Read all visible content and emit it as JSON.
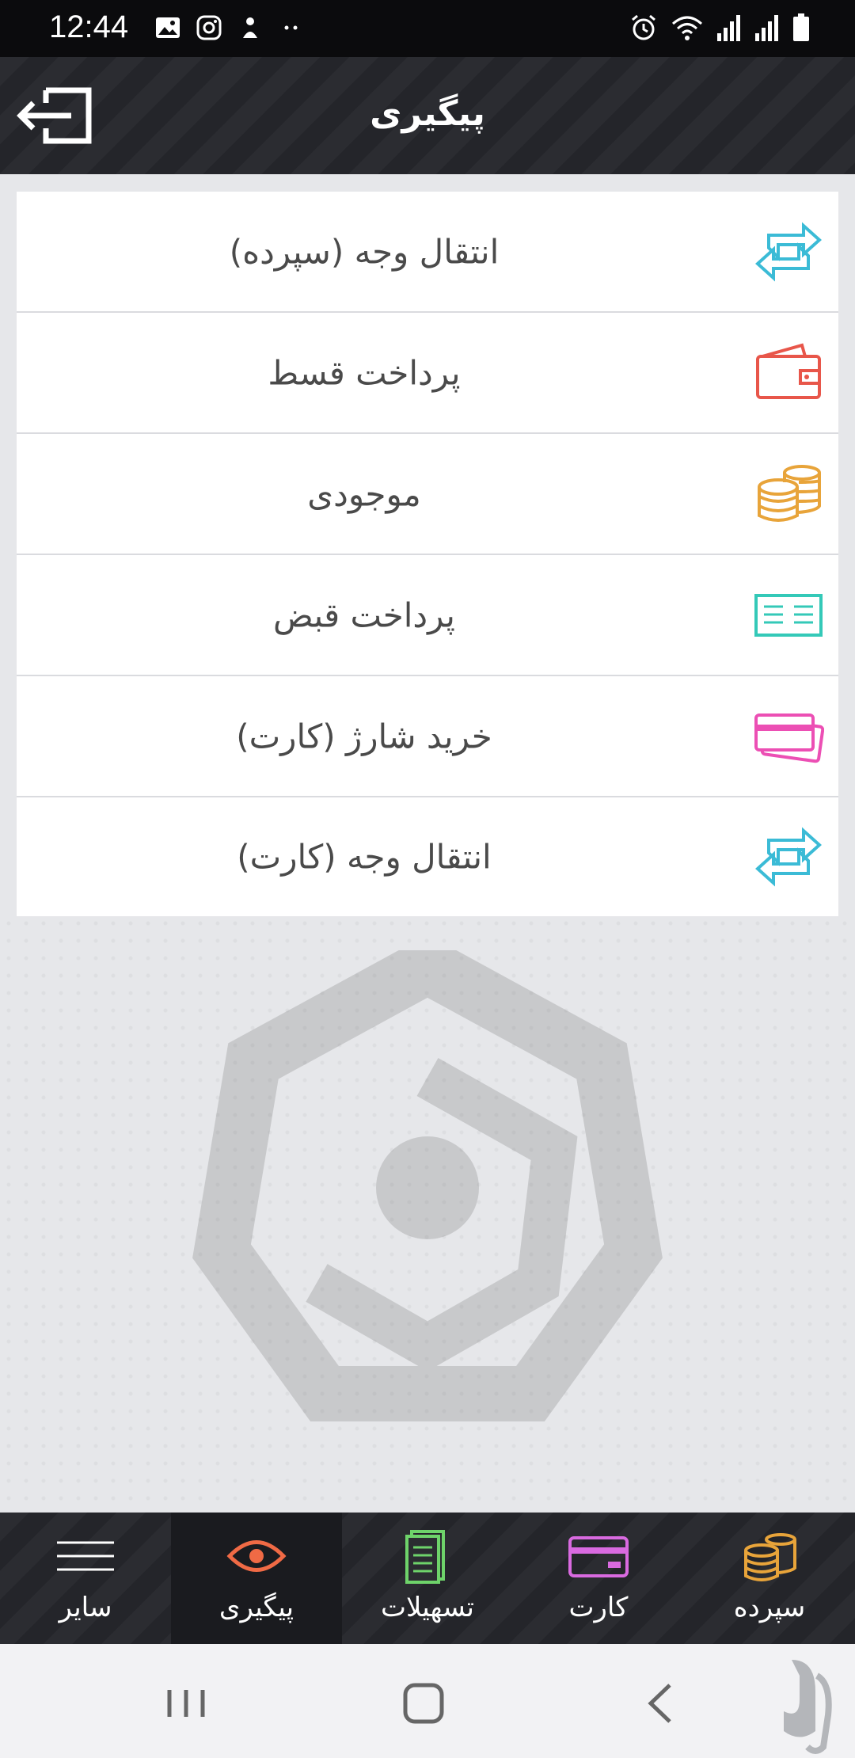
{
  "status_bar": {
    "time": "12:44"
  },
  "header": {
    "title": "پیگیری"
  },
  "menu": {
    "items": [
      {
        "label": "انتقال وجه (سپرده)",
        "icon": "transfer-arrows-icon",
        "color": "#3bbbd6"
      },
      {
        "label": "پرداخت قسط",
        "icon": "wallet-icon",
        "color": "#e8564a"
      },
      {
        "label": "موجودی",
        "icon": "coins-icon",
        "color": "#e8a43a"
      },
      {
        "label": "پرداخت قبض",
        "icon": "bill-icon",
        "color": "#34c9b8"
      },
      {
        "label": "خرید شارژ (کارت)",
        "icon": "cards-icon",
        "color": "#ec4fb4"
      },
      {
        "label": "انتقال وجه (کارت)",
        "icon": "transfer-arrows-icon",
        "color": "#3bbbd6"
      }
    ]
  },
  "bottom_nav": {
    "items": [
      {
        "label": "سایر",
        "icon": "hamburger-menu-icon",
        "color": "#ffffff"
      },
      {
        "label": "پیگیری",
        "icon": "eye-icon",
        "color": "#f06a45",
        "active": true
      },
      {
        "label": "تسهیلات",
        "icon": "document-icon",
        "color": "#6ed36a"
      },
      {
        "label": "کارت",
        "icon": "credit-card-icon",
        "color": "#d96ae0"
      },
      {
        "label": "سپرده",
        "icon": "coins-icon",
        "color": "#e8a43a"
      }
    ]
  },
  "colors": {
    "header_bg": "#2b2c31",
    "page_bg": "#e6e7ea",
    "active_nav": "#1a1b1f"
  }
}
